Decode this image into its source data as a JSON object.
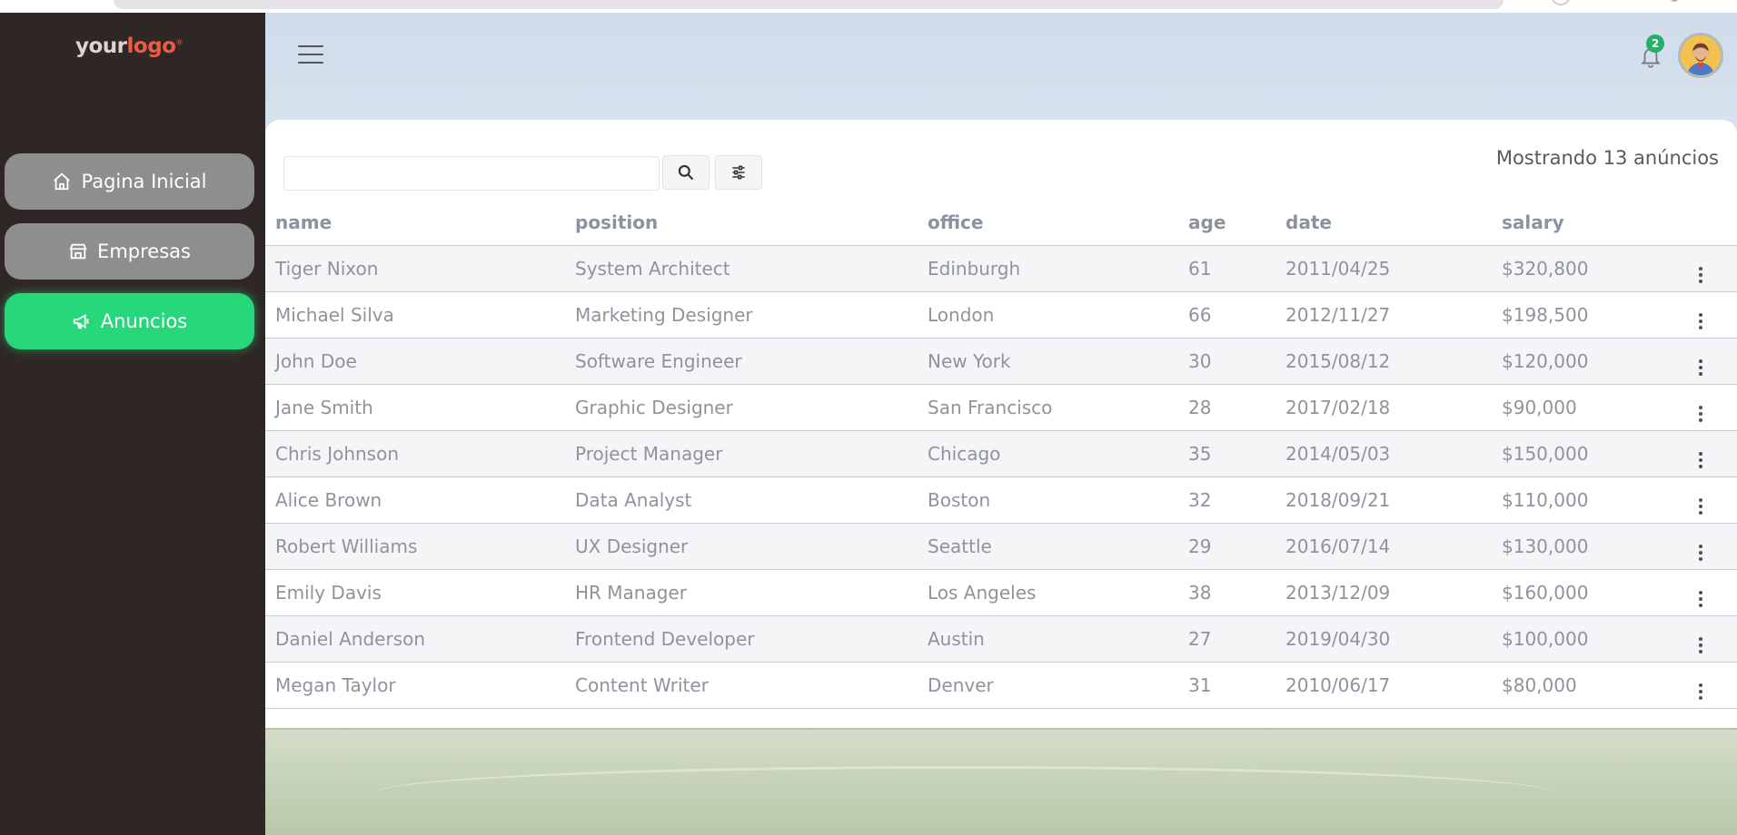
{
  "logo": {
    "part1": "your",
    "part2": "logo",
    "mark": "®"
  },
  "nav": [
    {
      "label": "Pagina Inicial",
      "icon": "home-icon",
      "active": false
    },
    {
      "label": "Empresas",
      "icon": "store-icon",
      "active": false
    },
    {
      "label": "Anuncios",
      "icon": "megaphone-icon",
      "active": true
    }
  ],
  "header": {
    "notification_count": "2"
  },
  "search": {
    "placeholder": "",
    "value": ""
  },
  "count_text": "Mostrando 13 anúncios",
  "table": {
    "columns": [
      "name",
      "position",
      "office",
      "age",
      "date",
      "salary"
    ],
    "rows": [
      [
        "Tiger Nixon",
        "System Architect",
        "Edinburgh",
        "61",
        "2011/04/25",
        "$320,800"
      ],
      [
        "Michael Silva",
        "Marketing Designer",
        "London",
        "66",
        "2012/11/27",
        "$198,500"
      ],
      [
        "John Doe",
        "Software Engineer",
        "New York",
        "30",
        "2015/08/12",
        "$120,000"
      ],
      [
        "Jane Smith",
        "Graphic Designer",
        "San Francisco",
        "28",
        "2017/02/18",
        "$90,000"
      ],
      [
        "Chris Johnson",
        "Project Manager",
        "Chicago",
        "35",
        "2014/05/03",
        "$150,000"
      ],
      [
        "Alice Brown",
        "Data Analyst",
        "Boston",
        "32",
        "2018/09/21",
        "$110,000"
      ],
      [
        "Robert Williams",
        "UX Designer",
        "Seattle",
        "29",
        "2016/07/14",
        "$130,000"
      ],
      [
        "Emily Davis",
        "HR Manager",
        "Los Angeles",
        "38",
        "2013/12/09",
        "$160,000"
      ],
      [
        "Daniel Anderson",
        "Frontend Developer",
        "Austin",
        "27",
        "2019/04/30",
        "$100,000"
      ],
      [
        "Megan Taylor",
        "Content Writer",
        "Denver",
        "31",
        "2010/06/17",
        "$80,000"
      ]
    ]
  },
  "colors": {
    "sidebar_bg": "#2f2725",
    "nav_inactive": "#8e8e8e",
    "nav_active": "#27d87a",
    "logo_accent": "#ee5c45",
    "badge": "#27ae6b"
  }
}
